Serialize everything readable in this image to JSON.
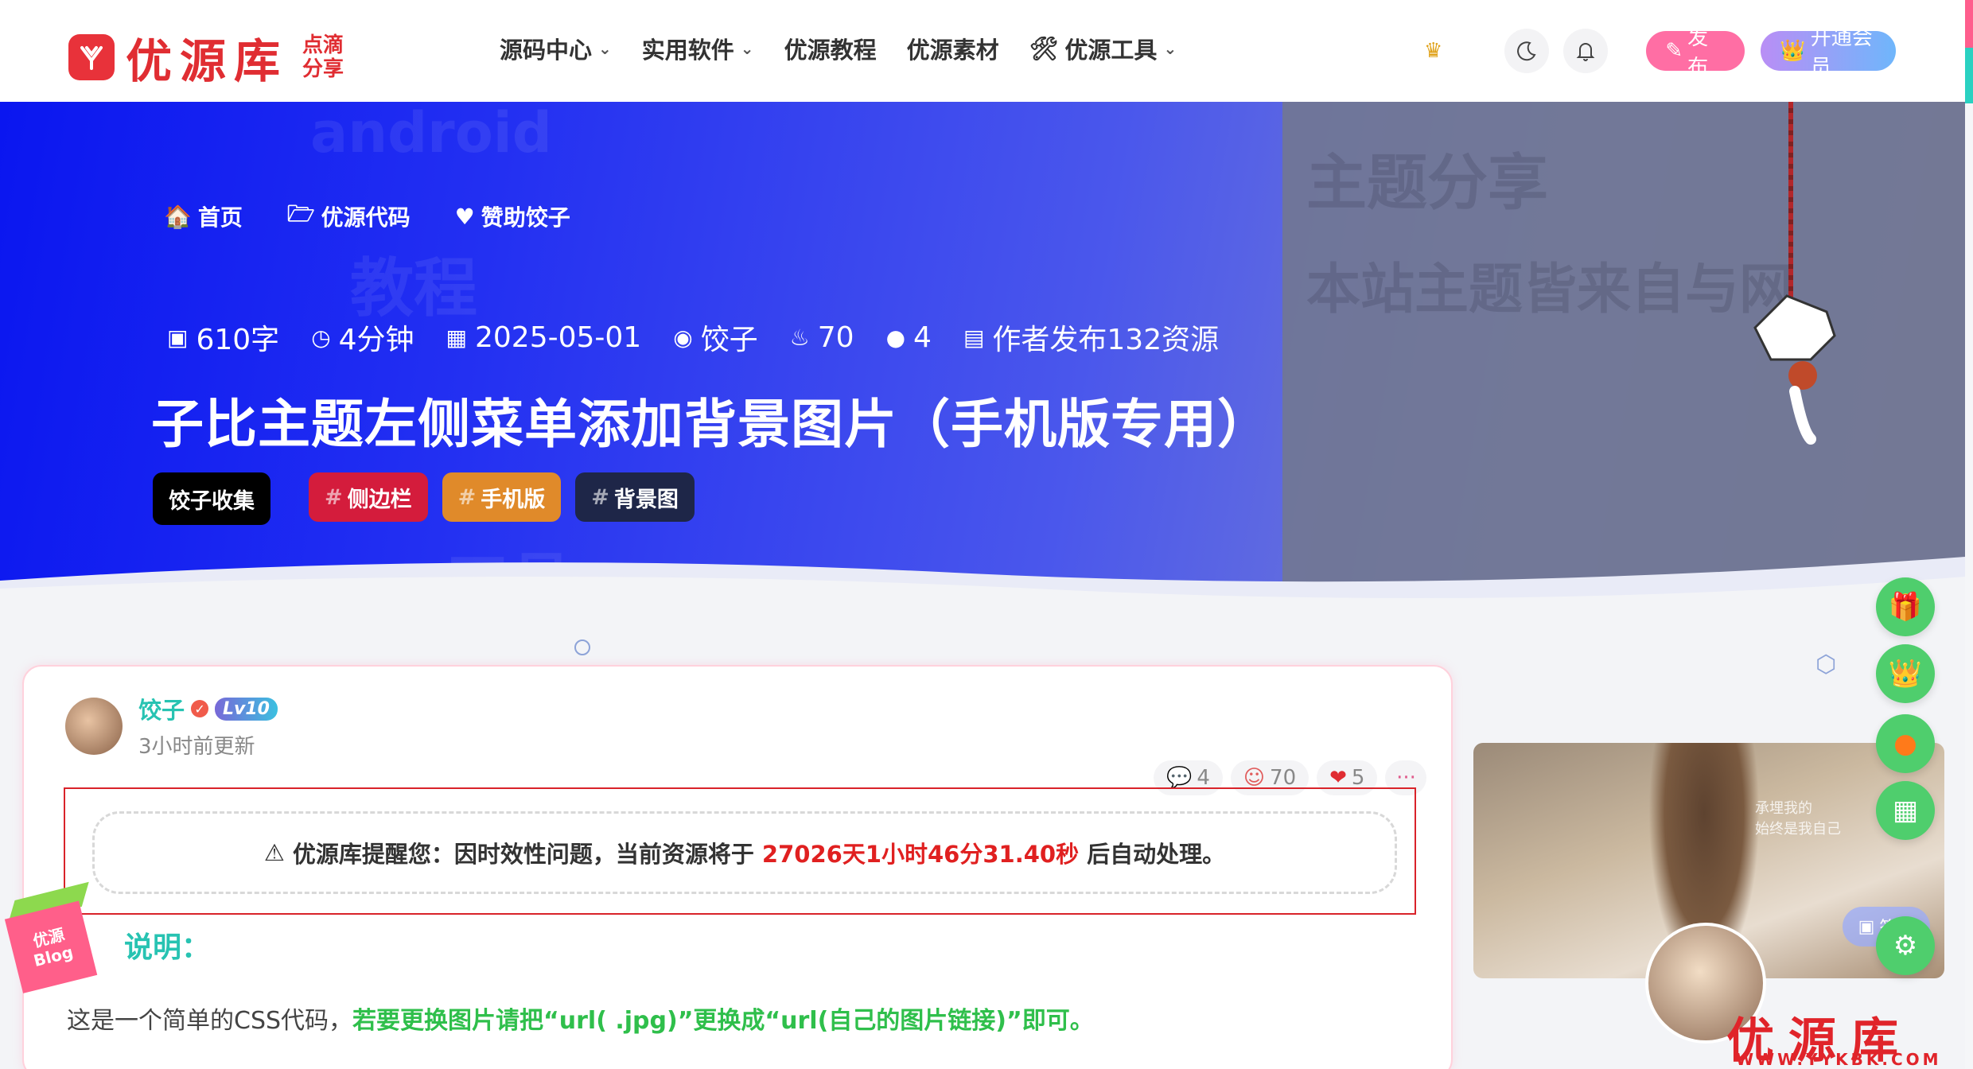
{
  "site": {
    "logo_text": "优源库",
    "logo_sub_1": "点滴",
    "logo_sub_2": "分享"
  },
  "nav": [
    {
      "label": "源码中心",
      "has_dropdown": true,
      "icon": ""
    },
    {
      "label": "实用软件",
      "has_dropdown": true,
      "icon": ""
    },
    {
      "label": "优源教程",
      "has_dropdown": false,
      "icon": ""
    },
    {
      "label": "优源素材",
      "has_dropdown": false,
      "icon": ""
    },
    {
      "label": "优源工具",
      "has_dropdown": true,
      "icon": "🛠"
    }
  ],
  "header_right": {
    "post_label": "发布",
    "vip_label": "开通会员",
    "post_icon": "✎",
    "vip_icon": "👑"
  },
  "hero": {
    "breadcrumbs": [
      {
        "label": "首页",
        "icon": "🏠"
      },
      {
        "label": "优源代码",
        "icon": "🗁"
      },
      {
        "label": "赞助饺子",
        "icon": "♥"
      }
    ],
    "meta": [
      {
        "icon": "▣",
        "text": "610字"
      },
      {
        "icon": "◷",
        "text": "4分钟"
      },
      {
        "icon": "▦",
        "text": "2025-05-01"
      },
      {
        "icon": "◉",
        "text": "饺子"
      },
      {
        "icon": "♨",
        "text": "70"
      },
      {
        "icon": "●",
        "text": "4"
      },
      {
        "icon": "▤",
        "text": "作者发布132资源"
      }
    ],
    "title": "子比主题左侧菜单添加背景图片（手机版专用）",
    "category": "饺子收集",
    "tags": [
      {
        "label": "侧边栏",
        "color": "#d41c3c"
      },
      {
        "label": "手机版",
        "color": "#e08a2a"
      },
      {
        "label": "背景图",
        "color": "#1e2648"
      }
    ]
  },
  "post": {
    "author_name": "饺子",
    "author_level": "Lv10",
    "author_time": "3小时前更新",
    "stats": {
      "comments": "4",
      "views": "70",
      "likes": "5",
      "more": "···"
    },
    "notice_prefix": "优源库提醒您：因时效性问题，当前资源将于",
    "notice_countdown": "27026天1小时46分31.40秒",
    "notice_suffix": "后自动处理。",
    "section_heading": "说明：",
    "body_plain": "这是一个简单的CSS代码，",
    "body_highlight": "若要更换图片请把“url( .jpg)”更换成“url(自己的图片链接)”即可。"
  },
  "sidebar": {
    "sign_label": "签到",
    "image_text_1": "承埋我的",
    "image_text_2": "始终是我自己"
  },
  "cube": {
    "line1": "优源",
    "line2": "Blog"
  },
  "watermark": {
    "text": "优源库",
    "sub": "WWW.YYKBK.COM"
  },
  "colors": {
    "brand_red": "#e02d32",
    "accent_teal": "#27c3b2",
    "float_green": "#4fce6d",
    "hero_blue": "#0a16f0"
  }
}
